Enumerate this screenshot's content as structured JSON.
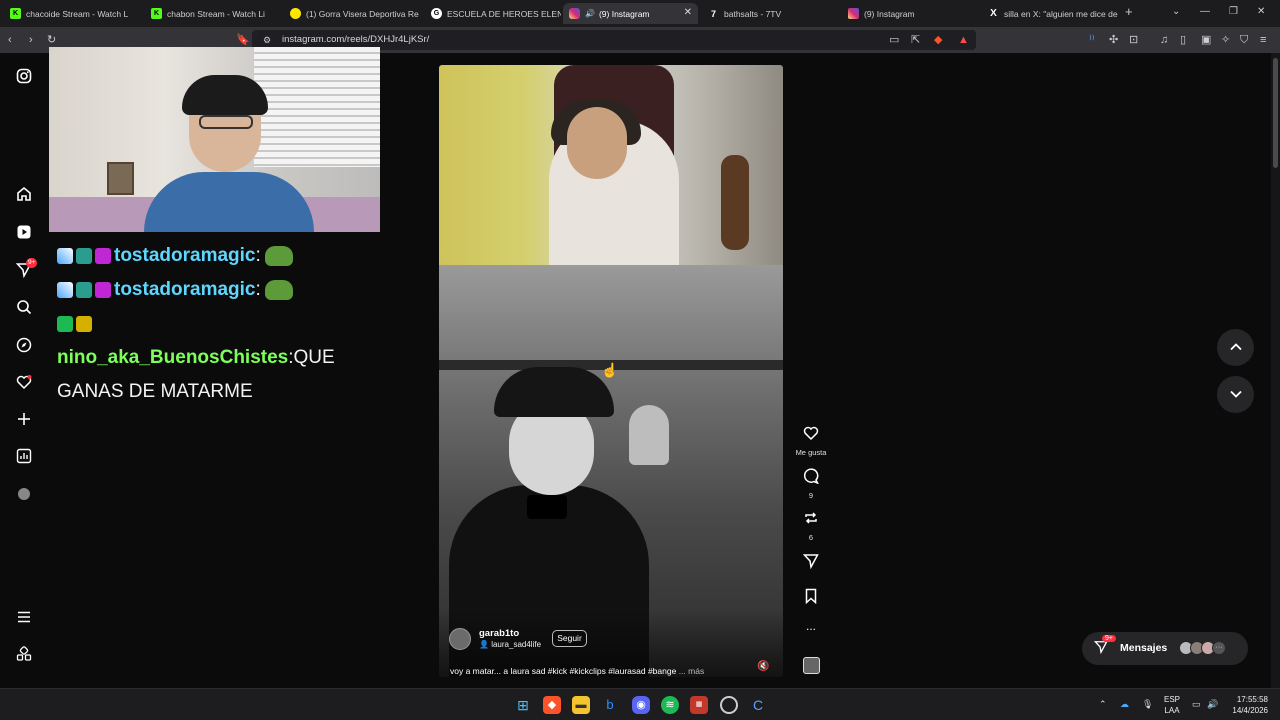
{
  "browser": {
    "tabs": [
      {
        "title": "chacoide Stream - Watch L",
        "icon": "kick-icon",
        "color": "#53fc18"
      },
      {
        "title": "chabon Stream - Watch Li",
        "icon": "kick-icon",
        "color": "#53fc18"
      },
      {
        "title": "(1) Gorra Visera Deportiva Re",
        "icon": "mercadolibre-icon",
        "color": "#ffe600"
      },
      {
        "title": "ESCUELA DE HEROES ELENCO",
        "icon": "google-icon",
        "color": "#ffffff"
      },
      {
        "title": "(9) Instagram",
        "icon": "instagram-icon",
        "color": "#e1306c",
        "active": true
      },
      {
        "title": "bathsalts - 7TV",
        "icon": "7tv-icon",
        "color": "#ffffff"
      },
      {
        "title": "(9) Instagram",
        "icon": "instagram-icon",
        "color": "#e1306c"
      },
      {
        "title": "silla en X: \"alguien me dice de",
        "icon": "x-icon",
        "color": "#ffffff"
      }
    ],
    "url": "instagram.com/reels/DXHJr4LjKSr/",
    "new_tab": "+"
  },
  "stream_overlay": {
    "chat": [
      {
        "user": "tostadoramagic",
        "sep": ":",
        "message": ""
      },
      {
        "user": "tostadoramagic",
        "sep": ":",
        "message": ""
      },
      {
        "user": "",
        "sep": "",
        "message": ""
      },
      {
        "user": "nino_aka_BuenosChistes",
        "sep": ":",
        "message": " QUE"
      },
      {
        "user": "",
        "sep": "",
        "message": "GANAS DE MATARME"
      }
    ]
  },
  "instagram": {
    "nav_badge": "9+",
    "reel": {
      "username": "garab1to",
      "audio": "laura_sad4life",
      "follow_label": "Seguir",
      "caption": "voy a matar... a laura sad #kick #kickclips #laurasad #bange",
      "more": "... más"
    },
    "actions": {
      "like_label": "Me gusta",
      "comments_count": "9",
      "reposts_count": "6",
      "more": "..."
    },
    "messages": {
      "label": "Mensajes",
      "badge": "9+"
    }
  },
  "taskbar": {
    "lang_top": "ESP",
    "lang_bottom": "LAA",
    "time": "17:55:58",
    "date": "14/4/2026"
  },
  "colors": {
    "accent_kick": "#53fc18",
    "chat_user_blue": "#5ed7ff",
    "chat_user_green": "#7cff5a",
    "instagram_badge": "#ff3040"
  }
}
